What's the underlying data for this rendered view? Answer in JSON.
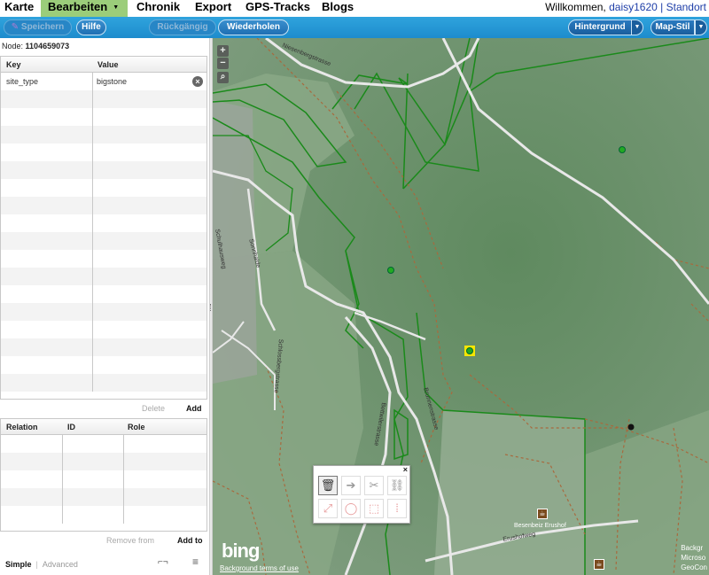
{
  "nav": {
    "tabs": [
      "Karte",
      "Bearbeiten",
      "Chronik",
      "Export",
      "GPS-Tracks",
      "Blogs"
    ],
    "active_tab": "Bearbeiten",
    "welcome_prefix": "Willkommen,",
    "username": "daisy1620",
    "separator": "|",
    "location_link": "Standort"
  },
  "toolbar": {
    "save": "Speichern",
    "help": "Hilfe",
    "undo": "Rückgängig",
    "redo": "Wiederholen",
    "background": "Hintergrund",
    "map_style": "Map-Stil"
  },
  "panel": {
    "node_label": "Node:",
    "node_id": "1104659073",
    "tags": {
      "col_key": "Key",
      "col_value": "Value",
      "rows": [
        {
          "key": "site_type",
          "value": "bigstone"
        }
      ],
      "delete": "Delete",
      "add": "Add"
    },
    "relations": {
      "col_relation": "Relation",
      "col_id": "ID",
      "col_role": "Role",
      "remove_from": "Remove from",
      "add_to": "Add to"
    },
    "modes": {
      "simple": "Simple",
      "advanced": "Advanced"
    }
  },
  "map": {
    "streets": [
      "Niesenbergstrasse",
      "Schulhausweg",
      "Sonnhalde",
      "Schlossbergstrasse",
      "Bettwilerstrasse",
      "Brunnenstrasse",
      "Erushofweg"
    ],
    "poi_label": "Besenbeiz Erushof",
    "bing": "bing",
    "terms": "Background terms of use",
    "attribution": [
      "Backgr",
      "Microso",
      "GeoCon"
    ]
  },
  "colors": {
    "nav_active": "#9bcd7a",
    "toolbar": "#1d8ccd",
    "forest_outline": "#1a8a1a",
    "selected_node": "#f5e600"
  }
}
